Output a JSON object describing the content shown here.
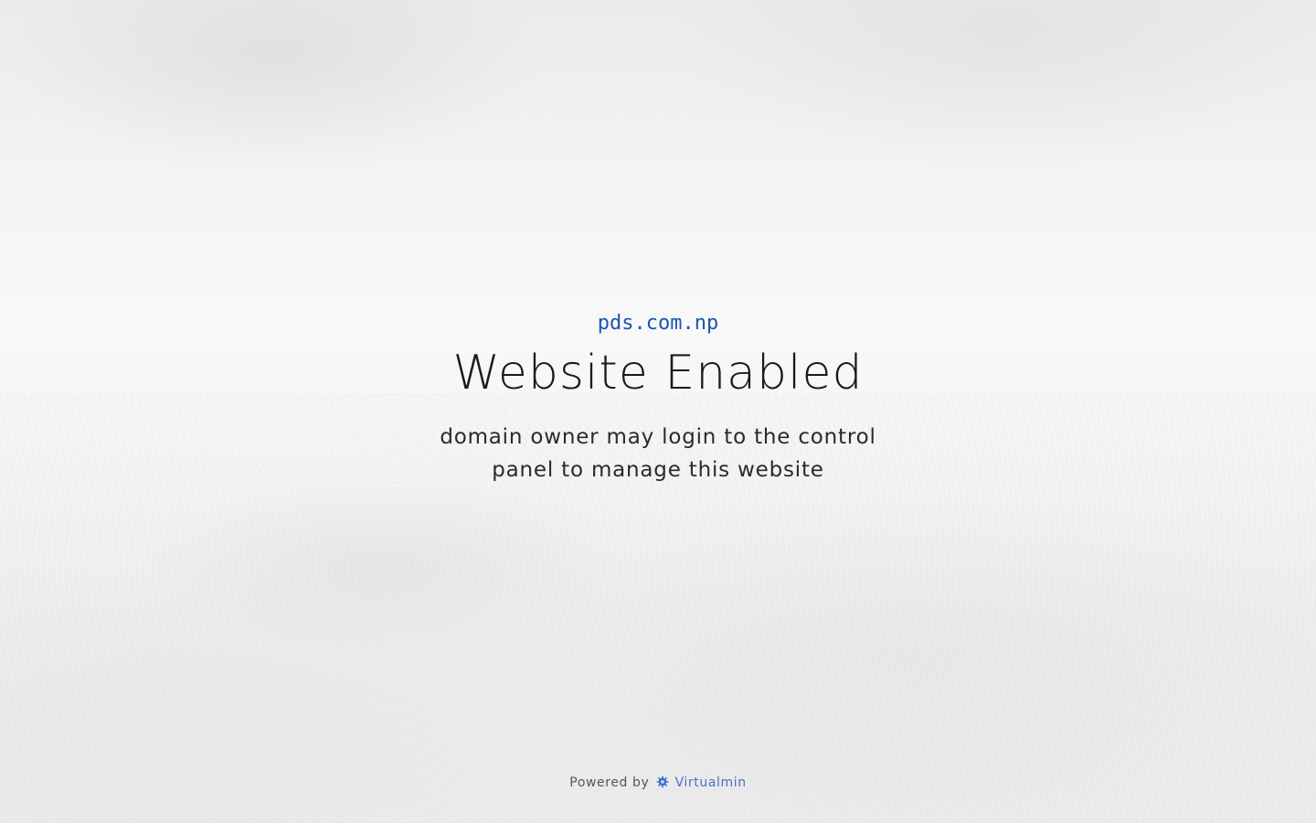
{
  "domain": "pds.com.np",
  "title": "Website Enabled",
  "subtitle": "domain owner may login to the control panel to manage this website",
  "footer": {
    "powered_by": "Powered by",
    "link_label": "Virtualmin",
    "icon": "virtualmin-gear-icon"
  },
  "colors": {
    "domain": "#1f52b5",
    "link": "#4a6fc8",
    "title": "#1a1a1a"
  }
}
